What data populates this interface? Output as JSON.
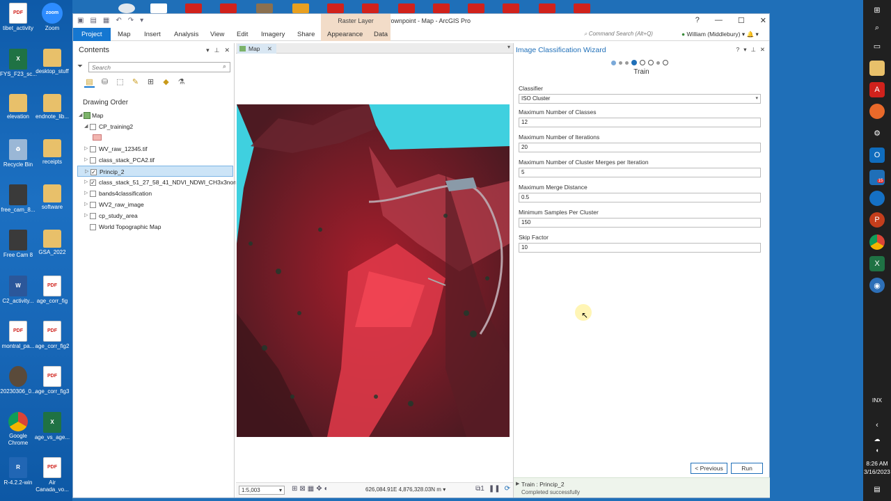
{
  "desktop": {
    "icons": [
      {
        "label": "tibet_activity",
        "kind": "pdf"
      },
      {
        "label": "Zoom",
        "kind": "zoom"
      },
      {
        "label": "FYS_F23_sc...",
        "kind": "xls"
      },
      {
        "label": "desktop_stuff",
        "kind": "folder"
      },
      {
        "label": "elevation",
        "kind": "folder"
      },
      {
        "label": "endnote_lib...",
        "kind": "folder"
      },
      {
        "label": "Recycle Bin",
        "kind": "recycle"
      },
      {
        "label": "receipts",
        "kind": "folder"
      },
      {
        "label": "free_cam_8...",
        "kind": "cam"
      },
      {
        "label": "software",
        "kind": "folder"
      },
      {
        "label": "Free Cam 8",
        "kind": "cam"
      },
      {
        "label": "GSA_2022",
        "kind": "folder"
      },
      {
        "label": "C2_activity...",
        "kind": "word"
      },
      {
        "label": "age_corr_fig",
        "kind": "pdf"
      },
      {
        "label": "montral_pa...",
        "kind": "pdf"
      },
      {
        "label": "age_corr_fig2",
        "kind": "pdf"
      },
      {
        "label": "20230306_0...",
        "kind": "photo"
      },
      {
        "label": "age_corr_fig3",
        "kind": "pdf"
      },
      {
        "label": "Google Chrome",
        "kind": "chrome"
      },
      {
        "label": "age_vs_age...",
        "kind": "xls"
      },
      {
        "label": "R-4.2.2-win",
        "kind": "r"
      },
      {
        "label": "Air Canada_vo...",
        "kind": "pdf"
      }
    ]
  },
  "taskbar": {
    "time": "8:26 AM",
    "date": "3/16/2023",
    "inx": "INX",
    "badge": "15"
  },
  "window": {
    "title": "lab5-crownpoint - Map - ArcGIS Pro",
    "context_tab_group": "Raster Layer",
    "help": "?",
    "tabs": [
      "Project",
      "Map",
      "Insert",
      "Analysis",
      "View",
      "Edit",
      "Imagery",
      "Share",
      "Appearance",
      "Data"
    ],
    "command_search_placeholder": "Command Search (Alt+Q)",
    "user": "William (Middlebury)"
  },
  "contents": {
    "title": "Contents",
    "search_placeholder": "Search",
    "drawing_order": "Drawing Order",
    "map_name": "Map",
    "layers": [
      {
        "name": "CP_training2",
        "checked": false,
        "expanded": true,
        "selected": false
      },
      {
        "name": "WV_raw_12345.tif",
        "checked": false,
        "expanded": false,
        "selected": false
      },
      {
        "name": "class_stack_PCA2.tif",
        "checked": false,
        "expanded": false,
        "selected": false
      },
      {
        "name": "Princip_2",
        "checked": true,
        "expanded": false,
        "selected": true
      },
      {
        "name": "class_stack_51_27_58_41_NDVI_NDWI_CH3x3norm.tif",
        "checked": true,
        "expanded": false,
        "selected": false
      },
      {
        "name": "bands4classification",
        "checked": false,
        "expanded": false,
        "selected": false
      },
      {
        "name": "WV2_raw_image",
        "checked": false,
        "expanded": false,
        "selected": false
      },
      {
        "name": "cp_study_area",
        "checked": false,
        "expanded": false,
        "selected": false
      },
      {
        "name": "World Topographic Map",
        "checked": false,
        "expanded": null,
        "selected": false
      }
    ]
  },
  "map": {
    "tab_label": "Map",
    "scale": "1:5,003",
    "coordinates": "626,084.91E 4,876,328.03N m",
    "pause_count": "1"
  },
  "wizard": {
    "title": "Image Classification Wizard",
    "help": "?",
    "step_name": "Train",
    "fields": [
      {
        "label": "Classifier",
        "value": "ISO Cluster",
        "type": "select"
      },
      {
        "label": "Maximum Number of Classes",
        "value": "12",
        "type": "text"
      },
      {
        "label": "Maximum Number of Iterations",
        "value": "20",
        "type": "text"
      },
      {
        "label": "Maximum Number of Cluster Merges per Iteration",
        "value": "5",
        "type": "text"
      },
      {
        "label": "Maximum Merge Distance",
        "value": "0.5",
        "type": "text"
      },
      {
        "label": "Minimum Samples Per Cluster",
        "value": "150",
        "type": "text"
      },
      {
        "label": "Skip Factor",
        "value": "10",
        "type": "text"
      }
    ],
    "previous_label": "< Previous",
    "run_label": "Run",
    "status_title": "Train : Princip_2",
    "status_detail": "Completed successfully"
  }
}
